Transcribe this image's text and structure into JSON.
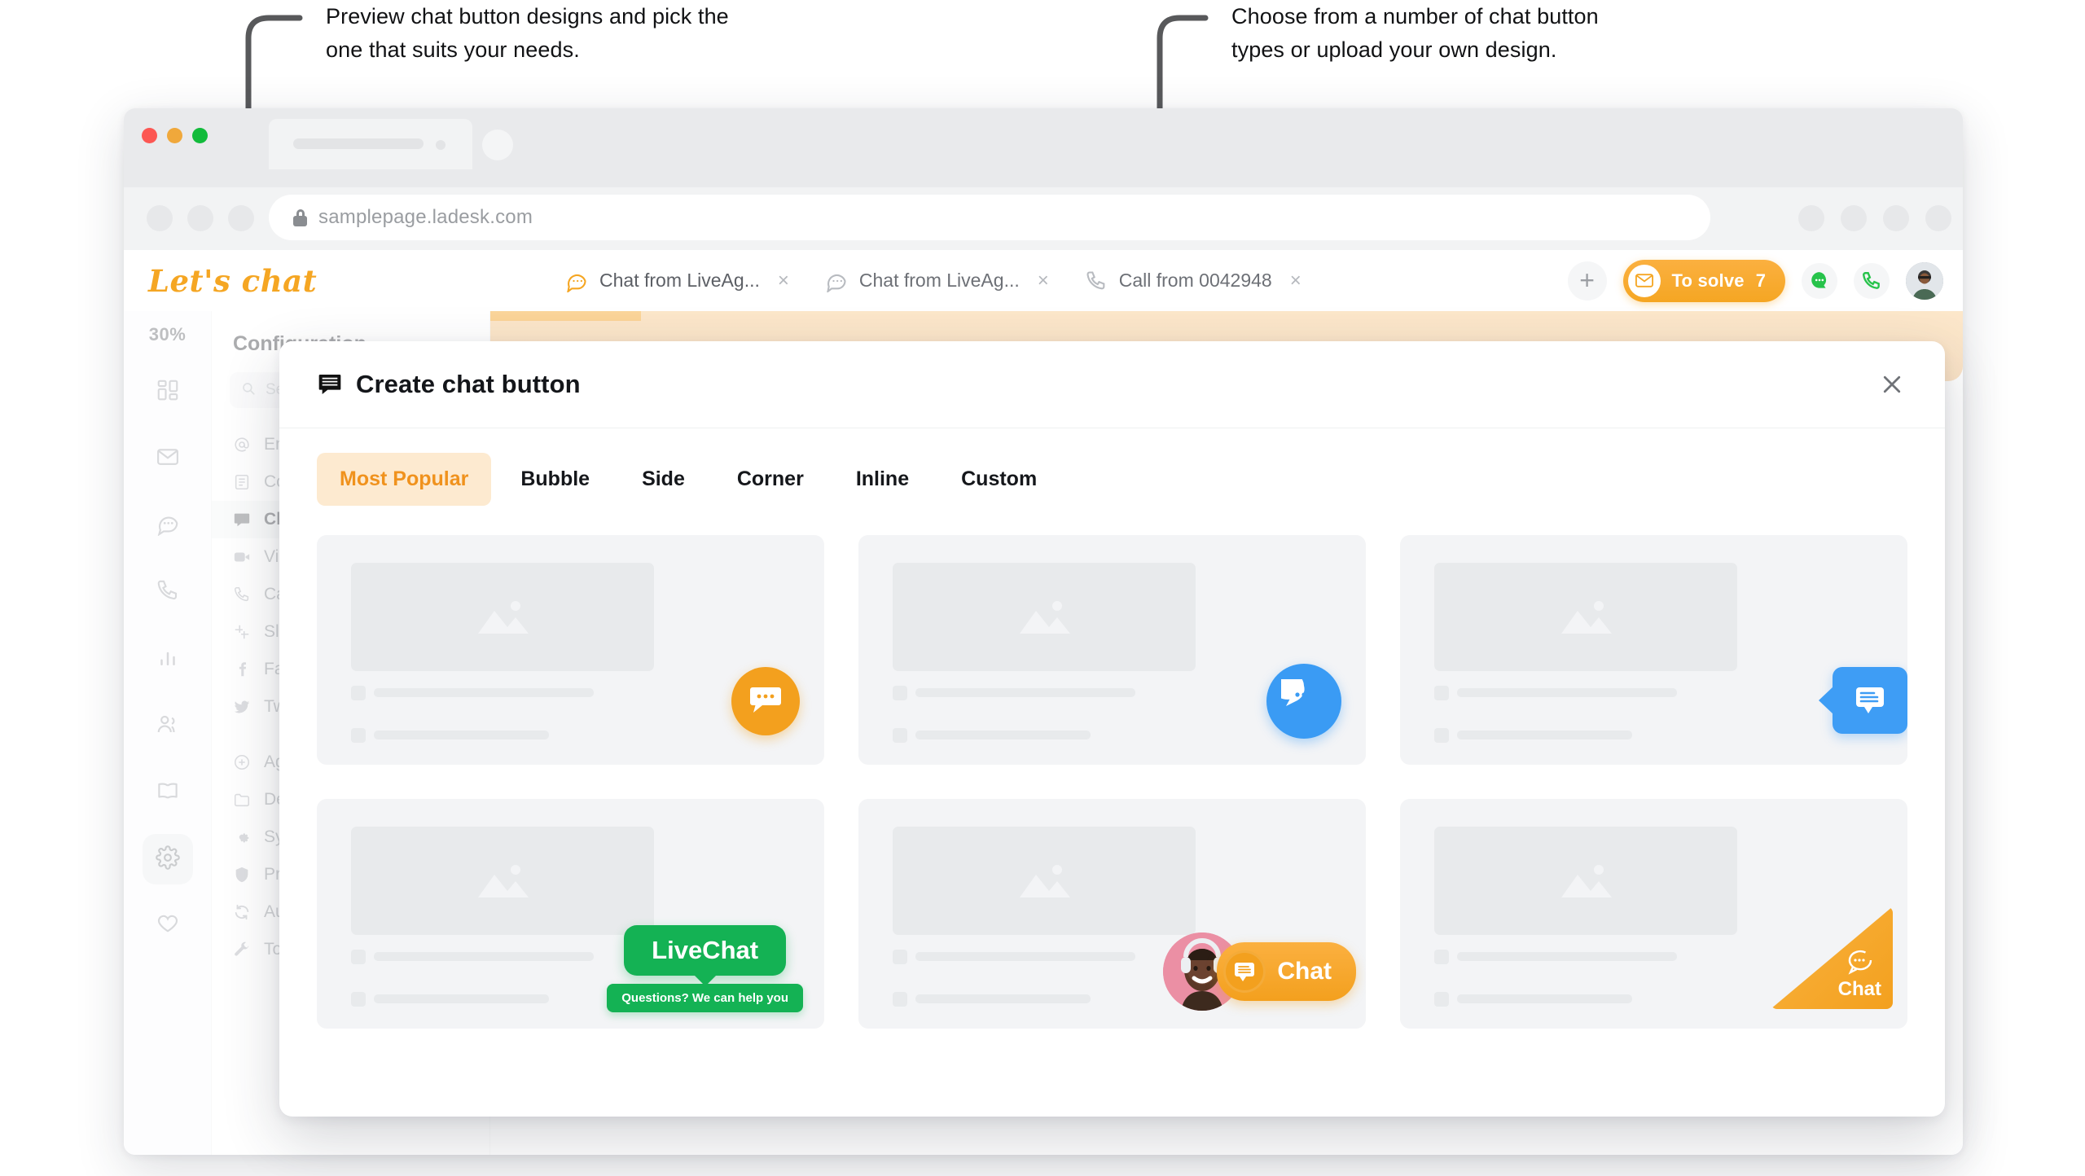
{
  "annotations": {
    "left": "Preview chat button designs and pick the\none that suits your needs.",
    "right": "Choose from a number of chat button\ntypes or upload your own design."
  },
  "browser": {
    "url": "samplepage.ladesk.com",
    "lock_icon": "lock-icon",
    "traffic_lights": [
      "close",
      "minimize",
      "maximize"
    ]
  },
  "app_header": {
    "brand": "Let's chat",
    "tabs": [
      {
        "label": "Chat from LiveAg...",
        "icon": "chat-bubble-icon",
        "close": "×",
        "active": true
      },
      {
        "label": "Chat from LiveAg...",
        "icon": "chat-bubble-icon",
        "close": "×",
        "active": false
      },
      {
        "label": "Call from 0042948",
        "icon": "phone-icon",
        "close": "×",
        "active": false
      }
    ],
    "add_label": "+",
    "to_solve": {
      "label": "To solve",
      "count": "7",
      "icon": "envelope-icon",
      "color": "#f5a623"
    },
    "chat_icon": "chat-green-icon",
    "phone_icon": "phone-green-icon",
    "avatar": "agent-avatar"
  },
  "rail": {
    "progress": "30%",
    "items": [
      {
        "name": "dashboard-icon"
      },
      {
        "name": "mail-icon"
      },
      {
        "name": "chat-icon"
      },
      {
        "name": "phone-icon"
      },
      {
        "name": "reports-icon"
      },
      {
        "name": "customers-icon"
      },
      {
        "name": "knowledge-base-icon"
      },
      {
        "name": "settings-icon",
        "selected": true
      },
      {
        "name": "heart-icon"
      }
    ]
  },
  "configuration": {
    "title": "Configuration",
    "search_placeholder": "Search",
    "items": [
      {
        "label": "Email",
        "icon": "at-icon"
      },
      {
        "label": "Contacts",
        "icon": "contacts-icon"
      },
      {
        "label": "Chat",
        "icon": "chat-icon",
        "selected": true
      },
      {
        "label": "Video",
        "icon": "video-icon"
      },
      {
        "label": "Call",
        "icon": "phone-icon"
      },
      {
        "label": "Slack",
        "icon": "slack-icon"
      },
      {
        "label": "Facebook",
        "icon": "facebook-icon"
      },
      {
        "label": "Twitter",
        "icon": "twitter-icon"
      }
    ],
    "items2": [
      {
        "label": "Agents",
        "icon": "agents-icon"
      },
      {
        "label": "Departments",
        "icon": "folder-icon"
      },
      {
        "label": "System",
        "icon": "gear-icon"
      },
      {
        "label": "Protection",
        "icon": "shield-icon"
      },
      {
        "label": "Automation",
        "icon": "refresh-icon"
      },
      {
        "label": "Tools",
        "icon": "wrench-icon"
      }
    ]
  },
  "modal": {
    "title": "Create chat button",
    "title_icon": "chat-board-icon",
    "close_icon": "close-icon",
    "tabs": [
      {
        "label": "Most Popular",
        "selected": true
      },
      {
        "label": "Bubble",
        "selected": false
      },
      {
        "label": "Side",
        "selected": false
      },
      {
        "label": "Corner",
        "selected": false
      },
      {
        "label": "Inline",
        "selected": false
      },
      {
        "label": "Custom",
        "selected": false
      }
    ],
    "accent_color": "#f0921d",
    "tab_selected_bg": "#fdead0",
    "cards": [
      {
        "name": "bubble-orange-card",
        "style": "bubble-orange",
        "color": "#f3a01e"
      },
      {
        "name": "bubble-blue-card",
        "style": "bubble-blue",
        "color": "#3a9bf4"
      },
      {
        "name": "side-tab-blue-card",
        "style": "side-tab-blue",
        "color": "#3e9df5"
      },
      {
        "name": "livechat-green-card",
        "style": "livechat-green",
        "color": "#14b254",
        "primary_label": "LiveChat",
        "secondary_label": "Questions? We can help you"
      },
      {
        "name": "agent-chat-pill-card",
        "style": "agent-pill",
        "color": "#f3a01e",
        "primary_label": "Chat"
      },
      {
        "name": "corner-triangle-card",
        "style": "corner-triangle",
        "color": "#f3a01e",
        "primary_label": "Chat"
      }
    ]
  }
}
